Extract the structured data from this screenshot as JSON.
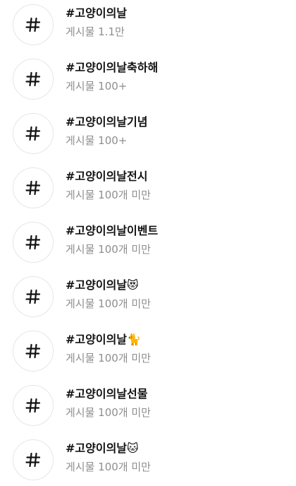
{
  "hashtags": [
    {
      "tag": "#고양이의날",
      "count": "게시물 1.1만"
    },
    {
      "tag": "#고양이의날축하해",
      "count": "게시물 100+"
    },
    {
      "tag": "#고양이의날기념",
      "count": "게시물 100+"
    },
    {
      "tag": "#고양이의날전시",
      "count": "게시물 100개 미만"
    },
    {
      "tag": "#고양이의날이벤트",
      "count": "게시물 100개 미만"
    },
    {
      "tag": "#고양이의날😻",
      "count": "게시물 100개 미만"
    },
    {
      "tag": "#고양이의날🐈",
      "count": "게시물 100개 미만"
    },
    {
      "tag": "#고양이의날선물",
      "count": "게시물 100개 미만"
    },
    {
      "tag": "#고양이의날🐱",
      "count": "게시물 100개 미만"
    }
  ],
  "icon": "hashtag-icon"
}
